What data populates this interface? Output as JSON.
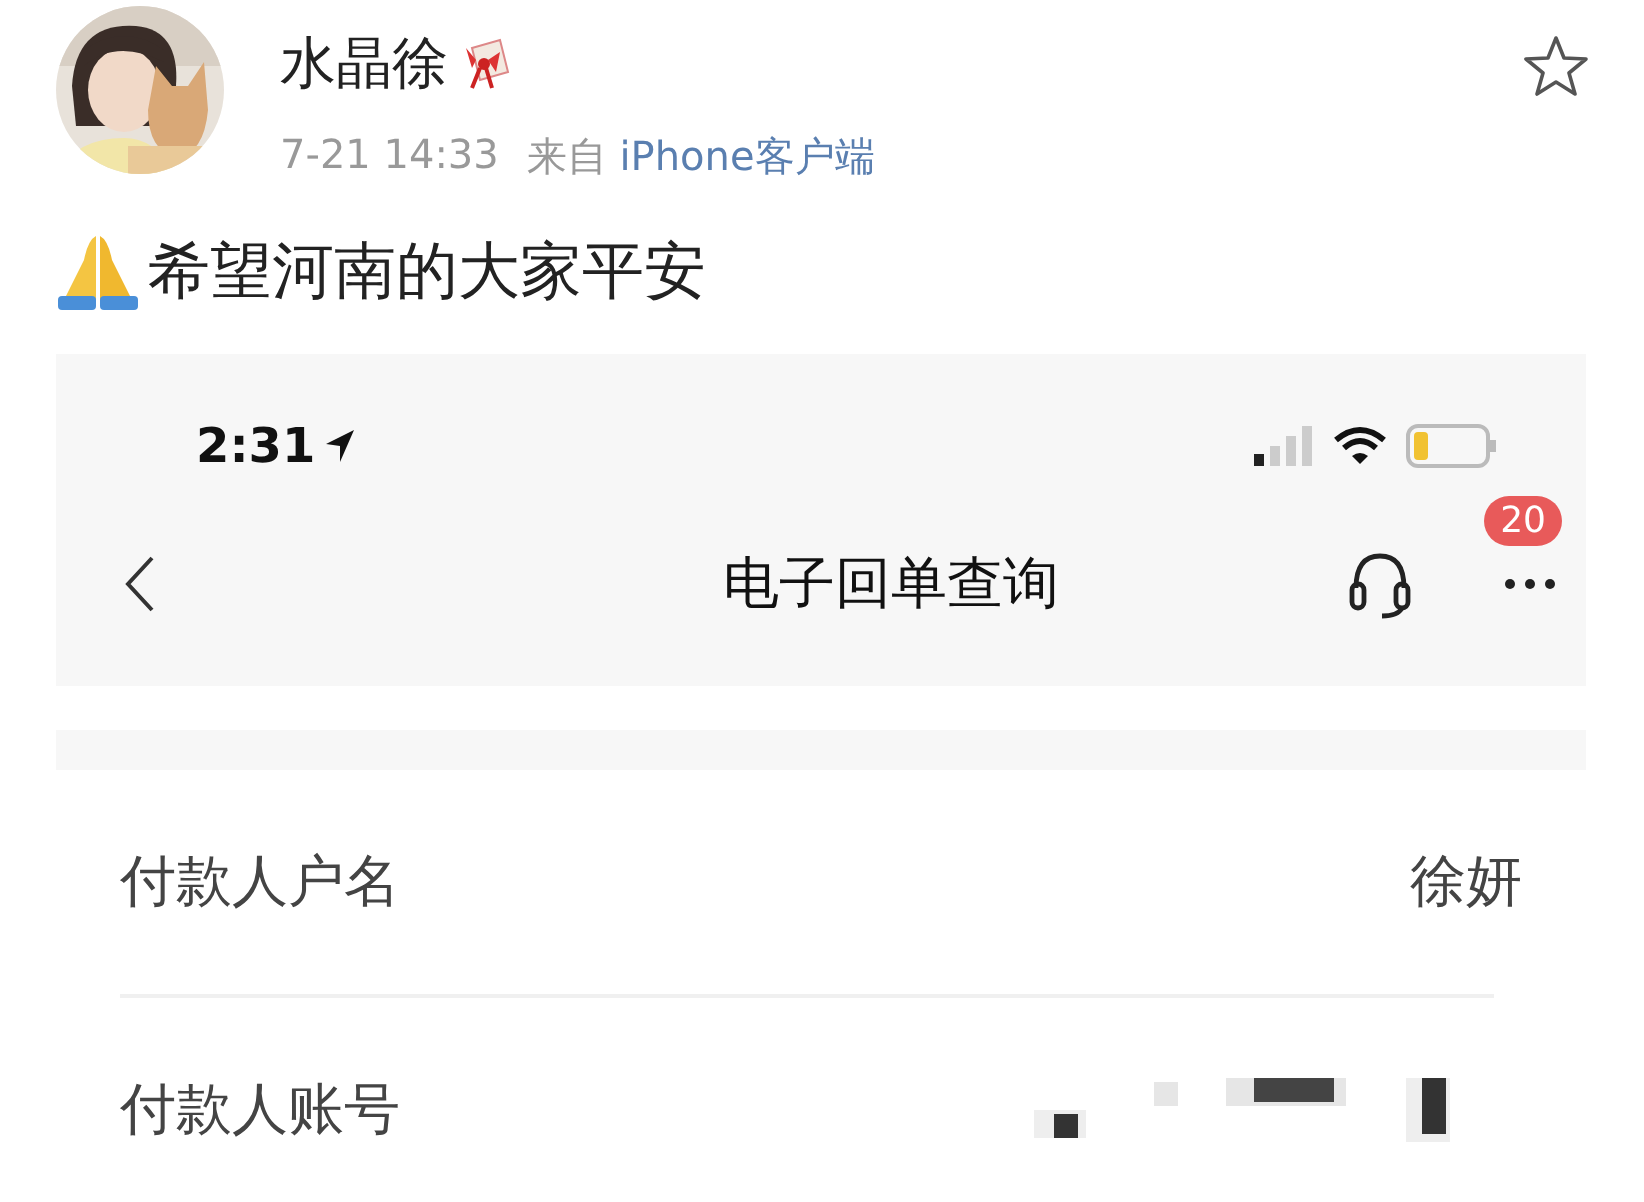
{
  "post": {
    "author": "水晶徐",
    "time": "7-21 14:33",
    "source_prefix": "来自",
    "source": "iPhone客户端",
    "text": "希望河南的大家平安"
  },
  "screenshot": {
    "status_time": "2:31",
    "nav_title": "电子回单查询",
    "badge": "20",
    "rows": [
      {
        "label": "付款人户名",
        "value": "徐妍",
        "kind": "text"
      },
      {
        "label": "付款人账号",
        "kind": "redacted"
      }
    ]
  }
}
